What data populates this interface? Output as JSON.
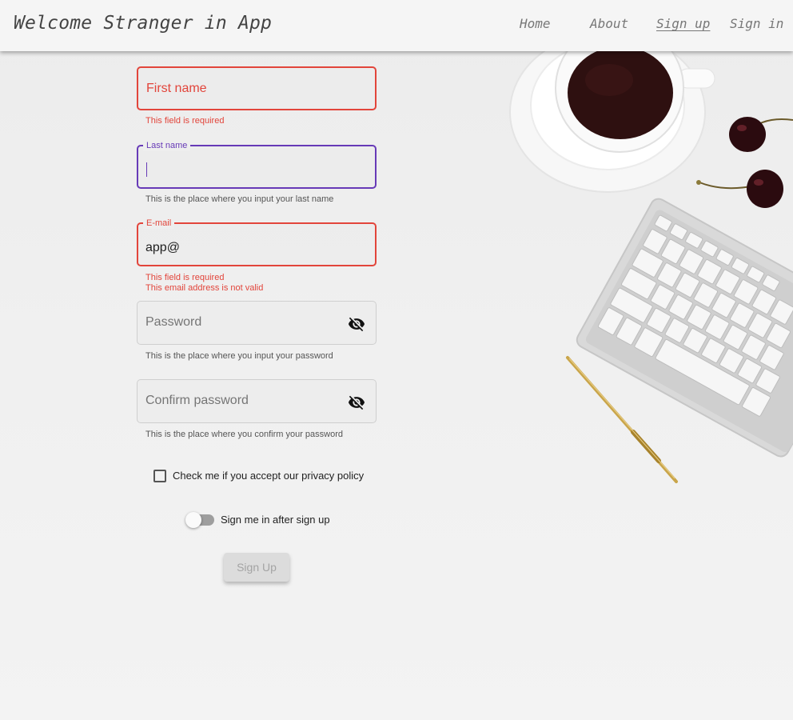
{
  "app": {
    "brand": "Welcome Stranger in App"
  },
  "nav": [
    {
      "label": "Home",
      "active": false
    },
    {
      "label": "About",
      "active": false
    },
    {
      "label": "Sign up",
      "active": true
    },
    {
      "label": "Sign in",
      "active": false
    }
  ],
  "form": {
    "first_name": {
      "placeholder": "First name",
      "error": "This field is required",
      "state": "error"
    },
    "last_name": {
      "label": "Last name",
      "value": "",
      "hint": "This is the place where you input your last name",
      "state": "focused"
    },
    "email": {
      "label": "E-mail",
      "value": "app@",
      "errors": [
        "This field is required",
        "This email address is not valid"
      ],
      "state": "error"
    },
    "password": {
      "placeholder": "Password",
      "hint": "This is the place where you input your password",
      "icon": "visibility-off-icon"
    },
    "confirm_password": {
      "placeholder": "Confirm password",
      "hint": "This is the place where you confirm your password",
      "icon": "visibility-off-icon"
    },
    "privacy_checkbox": {
      "label": "Check me if you accept our privacy policy",
      "checked": false
    },
    "auto_signin_toggle": {
      "label": "Sign me in after sign up",
      "on": false
    },
    "submit": {
      "label": "Sign Up",
      "disabled": true
    }
  },
  "colors": {
    "error": "#e2453b",
    "focus": "#673ab7",
    "toolbar": "#f5f5f5"
  }
}
